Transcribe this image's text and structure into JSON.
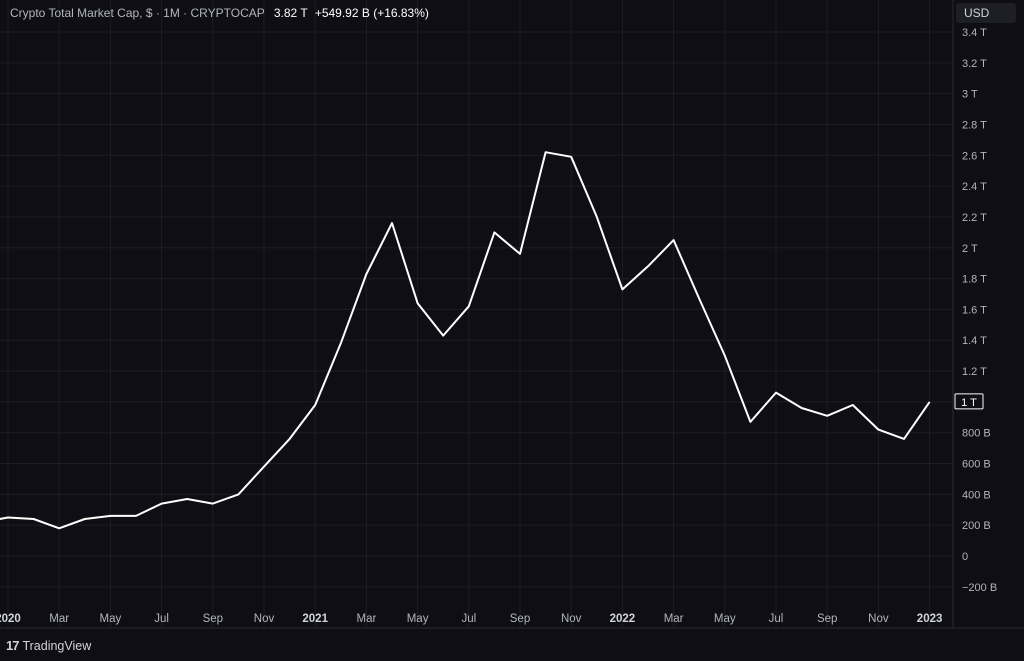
{
  "header": {
    "title": "Crypto Total Market Cap, $ · 1M · CRYPTOCAP",
    "last_value": "3.82 T",
    "change": "+549.92 B (+16.83%)"
  },
  "currency_button": "USD",
  "price_tag": "1 T",
  "brand": "TradingView",
  "colors": {
    "background": "#0e0e14",
    "line": "#ffffff",
    "grid": "#1c1e26",
    "text": "#b2b5be"
  },
  "chart_data": {
    "type": "line",
    "title": "",
    "xlabel": "",
    "ylabel": "",
    "grid": true,
    "ylim": [
      -0.3,
      3.45
    ],
    "y_unit": "trillion USD",
    "y_ticks": [
      {
        "v": -0.2,
        "label": "−200 B"
      },
      {
        "v": 0,
        "label": "0"
      },
      {
        "v": 0.2,
        "label": "200 B"
      },
      {
        "v": 0.4,
        "label": "400 B"
      },
      {
        "v": 0.6,
        "label": "600 B"
      },
      {
        "v": 0.8,
        "label": "800 B"
      },
      {
        "v": 1.2,
        "label": "1.2 T"
      },
      {
        "v": 1.4,
        "label": "1.4 T"
      },
      {
        "v": 1.6,
        "label": "1.6 T"
      },
      {
        "v": 1.8,
        "label": "1.8 T"
      },
      {
        "v": 2.0,
        "label": "2 T"
      },
      {
        "v": 2.2,
        "label": "2.2 T"
      },
      {
        "v": 2.4,
        "label": "2.4 T"
      },
      {
        "v": 2.6,
        "label": "2.6 T"
      },
      {
        "v": 2.8,
        "label": "2.8 T"
      },
      {
        "v": 3.0,
        "label": "3 T"
      },
      {
        "v": 3.2,
        "label": "3.2 T"
      },
      {
        "v": 3.4,
        "label": "3.4 T"
      }
    ],
    "x_ticks": [
      {
        "date": "2020-01",
        "label": "2020",
        "bold": true
      },
      {
        "date": "2020-03",
        "label": "Mar"
      },
      {
        "date": "2020-05",
        "label": "May"
      },
      {
        "date": "2020-07",
        "label": "Jul"
      },
      {
        "date": "2020-09",
        "label": "Sep"
      },
      {
        "date": "2020-11",
        "label": "Nov"
      },
      {
        "date": "2021-01",
        "label": "2021",
        "bold": true
      },
      {
        "date": "2021-03",
        "label": "Mar"
      },
      {
        "date": "2021-05",
        "label": "May"
      },
      {
        "date": "2021-07",
        "label": "Jul"
      },
      {
        "date": "2021-09",
        "label": "Sep"
      },
      {
        "date": "2021-11",
        "label": "Nov"
      },
      {
        "date": "2022-01",
        "label": "2022",
        "bold": true
      },
      {
        "date": "2022-03",
        "label": "Mar"
      },
      {
        "date": "2022-05",
        "label": "May"
      },
      {
        "date": "2022-07",
        "label": "Jul"
      },
      {
        "date": "2022-09",
        "label": "Sep"
      },
      {
        "date": "2022-11",
        "label": "Nov"
      },
      {
        "date": "2023-01",
        "label": "2023",
        "bold": true
      }
    ],
    "series": [
      {
        "x": [
          "2019-12",
          "2020-01",
          "2020-02",
          "2020-03",
          "2020-04",
          "2020-05",
          "2020-06",
          "2020-07",
          "2020-08",
          "2020-09",
          "2020-10",
          "2020-11",
          "2020-12",
          "2021-01",
          "2021-02",
          "2021-03",
          "2021-04",
          "2021-05",
          "2021-06",
          "2021-07",
          "2021-08",
          "2021-09",
          "2021-10",
          "2021-11",
          "2021-12",
          "2022-01",
          "2022-02",
          "2022-03",
          "2022-04",
          "2022-05",
          "2022-06",
          "2022-07",
          "2022-08",
          "2022-09",
          "2022-10",
          "2022-11",
          "2022-12",
          "2023-01"
        ],
        "values": [
          0.22,
          0.25,
          0.24,
          0.18,
          0.24,
          0.26,
          0.26,
          0.34,
          0.37,
          0.34,
          0.4,
          0.58,
          0.76,
          0.98,
          1.38,
          1.83,
          2.16,
          1.64,
          1.43,
          1.62,
          2.1,
          1.96,
          2.62,
          2.59,
          2.2,
          1.73,
          1.88,
          2.05,
          1.67,
          1.3,
          0.87,
          1.06,
          0.96,
          0.91,
          0.98,
          0.82,
          0.76,
          1.0
        ]
      }
    ]
  }
}
